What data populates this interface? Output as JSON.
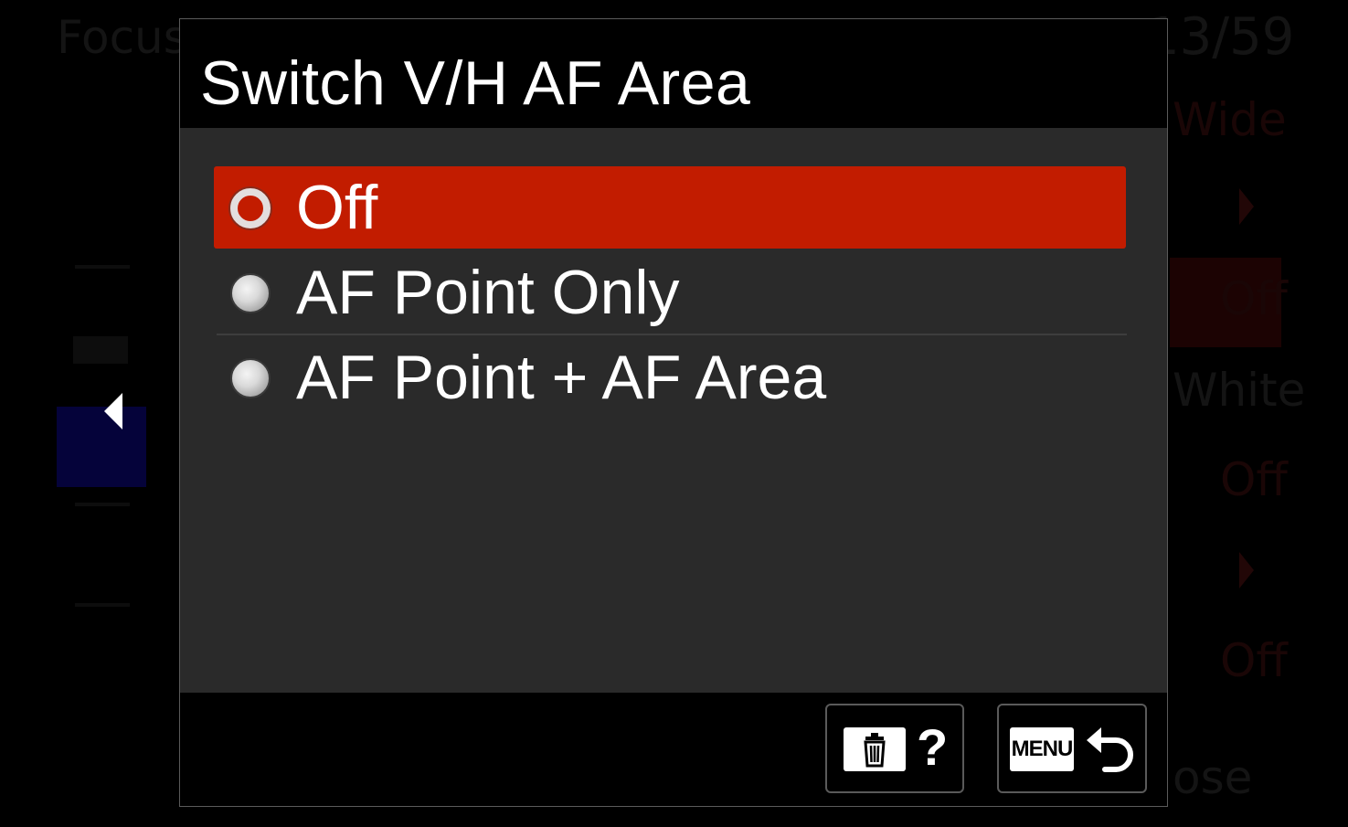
{
  "background_menu": {
    "title": "Focus",
    "page": "13/59",
    "items": [
      "Wide",
      "Off",
      "White",
      "Off",
      "Off"
    ],
    "close_label": "ose"
  },
  "dialog": {
    "title": "Switch V/H AF Area",
    "options": [
      {
        "label": "Off",
        "selected": true
      },
      {
        "label": "AF Point Only",
        "selected": false
      },
      {
        "label": "AF Point + AF Area",
        "selected": false
      }
    ],
    "footer": {
      "help_button": {
        "icons": [
          "trash-icon",
          "question-mark-icon"
        ],
        "label": "?"
      },
      "back_button": {
        "icons": [
          "menu-icon",
          "return-arrow-icon"
        ],
        "label": "MENU"
      }
    }
  },
  "colors": {
    "accent": "#c21c00",
    "dialog_body": "#2a2a2a",
    "header": "#000000",
    "text": "#ffffff"
  }
}
